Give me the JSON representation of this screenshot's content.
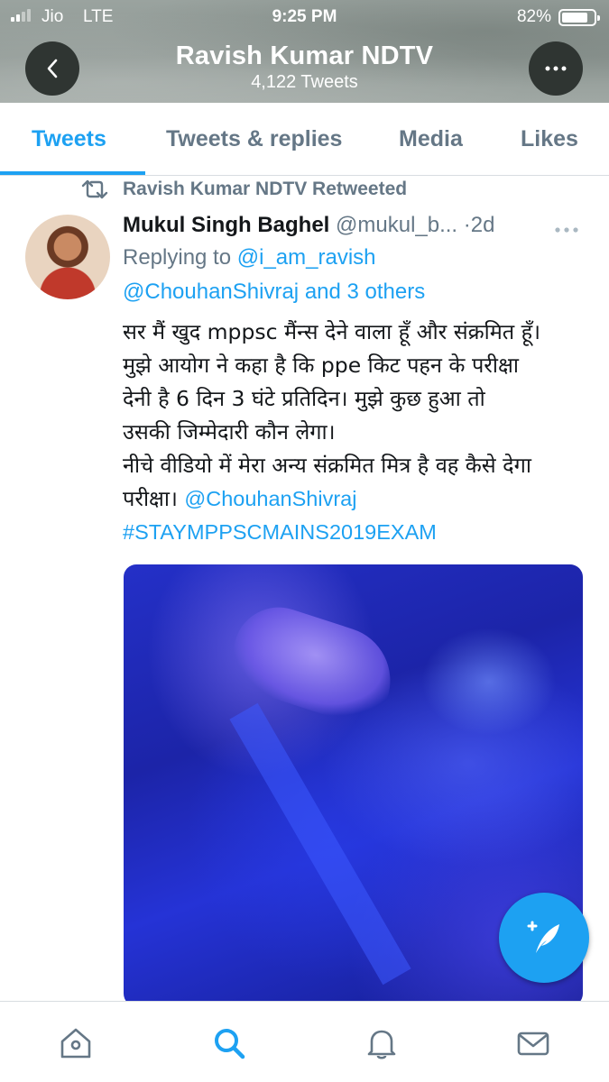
{
  "status_bar": {
    "carrier": "Jio",
    "network": "LTE",
    "time": "9:25 PM",
    "battery_percent": "82%",
    "battery_level": 0.82,
    "signal_bars_on": 2,
    "signal_bars_total": 4
  },
  "header": {
    "name": "Ravish Kumar NDTV",
    "tweet_count": "4,122 Tweets",
    "back_icon": "chevron-left-icon",
    "more_icon": "more-horizontal-icon"
  },
  "tabs": [
    {
      "label": "Tweets",
      "active": true
    },
    {
      "label": "Tweets & replies",
      "active": false
    },
    {
      "label": "Media",
      "active": false
    },
    {
      "label": "Likes",
      "active": false
    }
  ],
  "tweet": {
    "retweet_label": "Ravish Kumar NDTV Retweeted",
    "author_name": "Mukul Singh Baghel",
    "author_handle": "@mukul_b...",
    "separator": "·",
    "time": "2d",
    "replying_to_label": "Replying to",
    "replying_to_handle": "@i_am_ravish",
    "replying_to_others_handle": "@ChouhanShivraj",
    "replying_to_others_suffix": "and 3 others",
    "text_lines": [
      "सर मैं खुद mppsc मैंन्स देने वाला हूँ और संक्रमित हूँ।",
      "मुझे आयोग ने कहा है कि ppe किट पहन के परीक्षा",
      "देनी है 6 दिन 3 घंटे प्रतिदिन। मुझे कुछ हुआ तो",
      "उसकी जिम्मेदारी कौन लेगा।",
      "नीचे वीडियो में मेरा अन्य संक्रमित मित्र है वह कैसे देगा",
      "परीक्षा।"
    ],
    "text_mention": "@ChouhanShivraj",
    "hashtag": "#STAYMPPSCMAINS2019EXAM"
  },
  "fab": {
    "icon": "compose-tweet-icon"
  },
  "bottom_nav": [
    {
      "icon": "home-icon",
      "active": false
    },
    {
      "icon": "search-icon",
      "active": true
    },
    {
      "icon": "bell-icon",
      "active": false
    },
    {
      "icon": "mail-icon",
      "active": false
    }
  ],
  "colors": {
    "accent": "#1da1f2",
    "secondary_text": "#657786",
    "primary_text": "#14171a"
  }
}
